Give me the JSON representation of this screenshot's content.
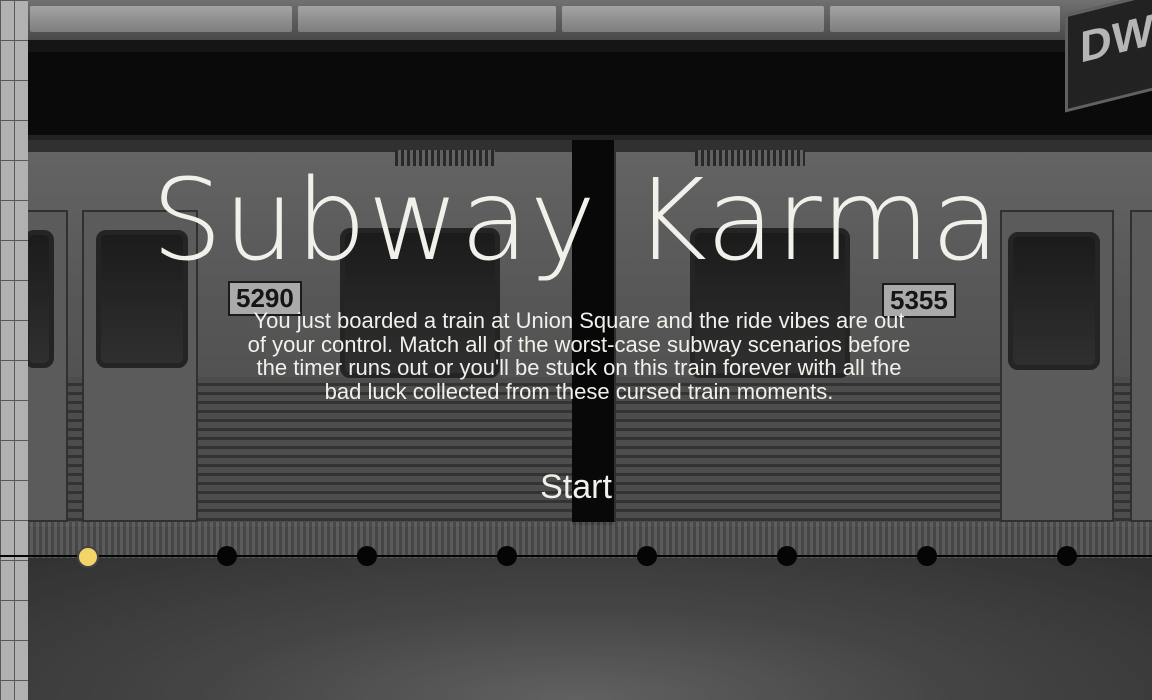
{
  "game": {
    "title": "Subway Karma",
    "description": "You just boarded a train at Union Square and the ride vibes are out of your control. Match all of the worst-case subway scenarios before the timer runs out or you'll be stuck on this train forever with all the bad luck collected from these cursed train moments.",
    "start_label": "Start"
  },
  "progress": {
    "total_stops": 8,
    "current_stop": 1,
    "active_color": "#f3d468",
    "inactive_color": "#050505"
  },
  "background": {
    "sign_text": "DW",
    "train_numbers": [
      "5290",
      "5355"
    ]
  }
}
